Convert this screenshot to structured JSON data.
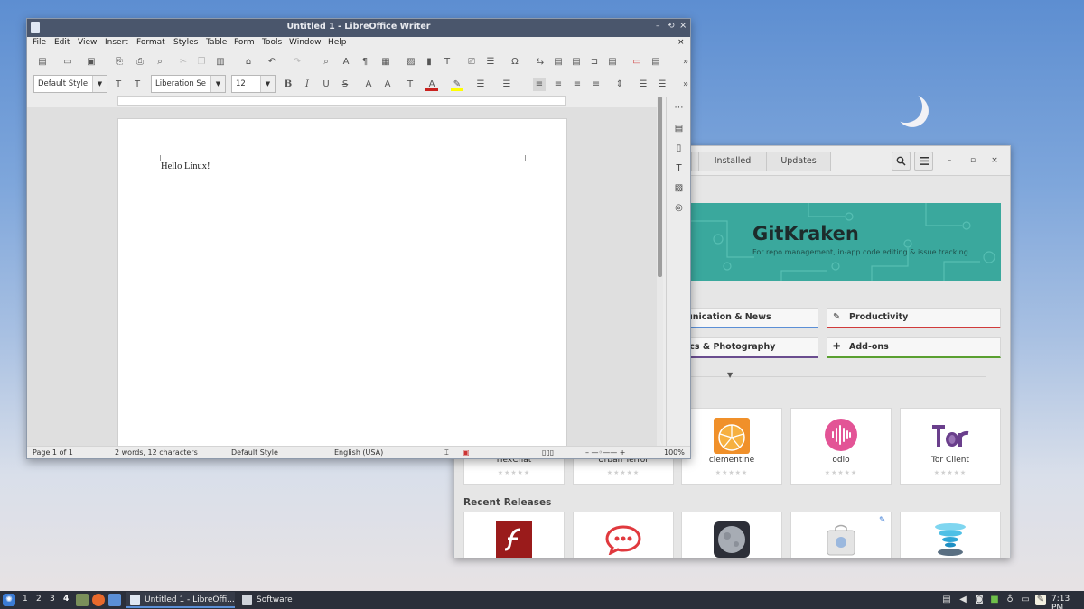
{
  "software": {
    "tabs": [
      "Installed",
      "Updates"
    ],
    "banner": {
      "title": "GitKraken",
      "subtitle": "For repo management, in-app code editing & issue tracking."
    },
    "categories": [
      {
        "label": "unication & News",
        "accent": "#5b8fd6",
        "icon": "comm-icon"
      },
      {
        "label": "Productivity",
        "accent": "#d03a3a",
        "icon": "edit-icon"
      },
      {
        "label": "ics & Photography",
        "accent": "#6a4d8f",
        "icon": "graphics-icon"
      },
      {
        "label": "Add-ons",
        "accent": "#5aa030",
        "icon": "puzzle-icon"
      }
    ],
    "featured_apps": [
      "HexChat",
      "Urban Terror",
      "clementine",
      "odio",
      "Tor Client"
    ],
    "recent_title": "Recent Releases"
  },
  "writer": {
    "title": "Untitled 1 - LibreOffice Writer",
    "menu": [
      "File",
      "Edit",
      "View",
      "Insert",
      "Format",
      "Styles",
      "Table",
      "Form",
      "Tools",
      "Window",
      "Help"
    ],
    "paragraph_style": "Default Style",
    "font_name": "Liberation Se",
    "font_size": "12",
    "document_text": "Hello Linux!",
    "status": {
      "page": "Page 1 of 1",
      "words": "2 words, 12 characters",
      "style": "Default Style",
      "language": "English (USA)",
      "zoom": "100%"
    }
  },
  "taskbar": {
    "workspaces": [
      "1",
      "2",
      "3",
      "4"
    ],
    "tasks": [
      {
        "label": "Untitled 1 - LibreOffi...",
        "active": true
      },
      {
        "label": "Software",
        "active": false
      }
    ],
    "clock": "7:13 PM"
  },
  "colors": {
    "accent": "#5b8fd6",
    "banner": "#3aa89d",
    "titlebar": "#4a566c"
  }
}
